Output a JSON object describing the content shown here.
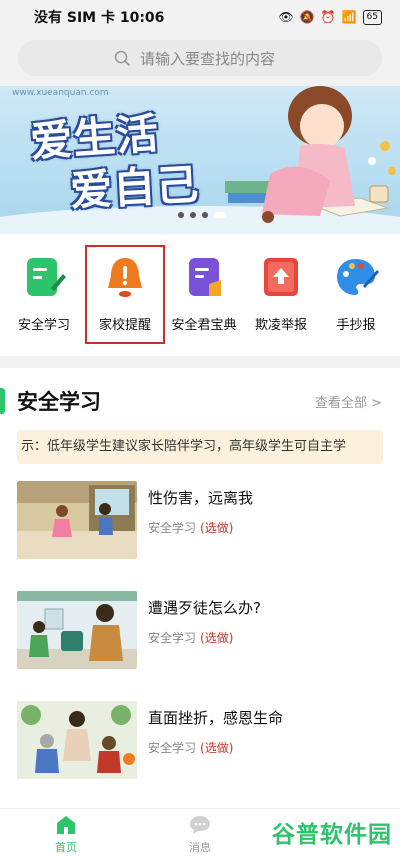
{
  "status_bar": {
    "carrier_time": "没有 SIM 卡 10:06",
    "battery": "65"
  },
  "search": {
    "placeholder": "请输入要查找的内容"
  },
  "banner": {
    "site": "www.xueanquan.com",
    "slogan_line1": "爱生活",
    "slogan_line2": "爱自己"
  },
  "quick_menu": [
    {
      "label": "安全学习",
      "icon": "document-pen-icon",
      "color": "#2ec46b"
    },
    {
      "label": "家校提醒",
      "icon": "bell-icon",
      "color": "#f07b1e"
    },
    {
      "label": "安全君宝典",
      "icon": "book-icon",
      "color": "#7a52d8"
    },
    {
      "label": "欺凌举报",
      "icon": "upload-report-icon",
      "color": "#e8453c"
    },
    {
      "label": "手抄报",
      "icon": "palette-icon",
      "color": "#2f8fe8"
    }
  ],
  "section": {
    "title": "安全学习",
    "view_all": "查看全部 >",
    "notice": "示：低年级学生建议家长陪伴学习，高年级学生可自主学"
  },
  "lessons": [
    {
      "title": "性伤害，远离我",
      "category": "安全学习",
      "tag": "(选做)"
    },
    {
      "title": "遭遇歹徒怎么办?",
      "category": "安全学习",
      "tag": "(选做)"
    },
    {
      "title": "直面挫折，感恩生命",
      "category": "安全学习",
      "tag": "(选做)"
    }
  ],
  "tabs": [
    {
      "label": "首页",
      "active": true
    },
    {
      "label": "消息",
      "active": false
    }
  ],
  "watermark": "谷普软件园",
  "colors": {
    "accent": "#2ec46b",
    "highlight": "#c8302c",
    "notice_bg": "#fbf1dc"
  }
}
